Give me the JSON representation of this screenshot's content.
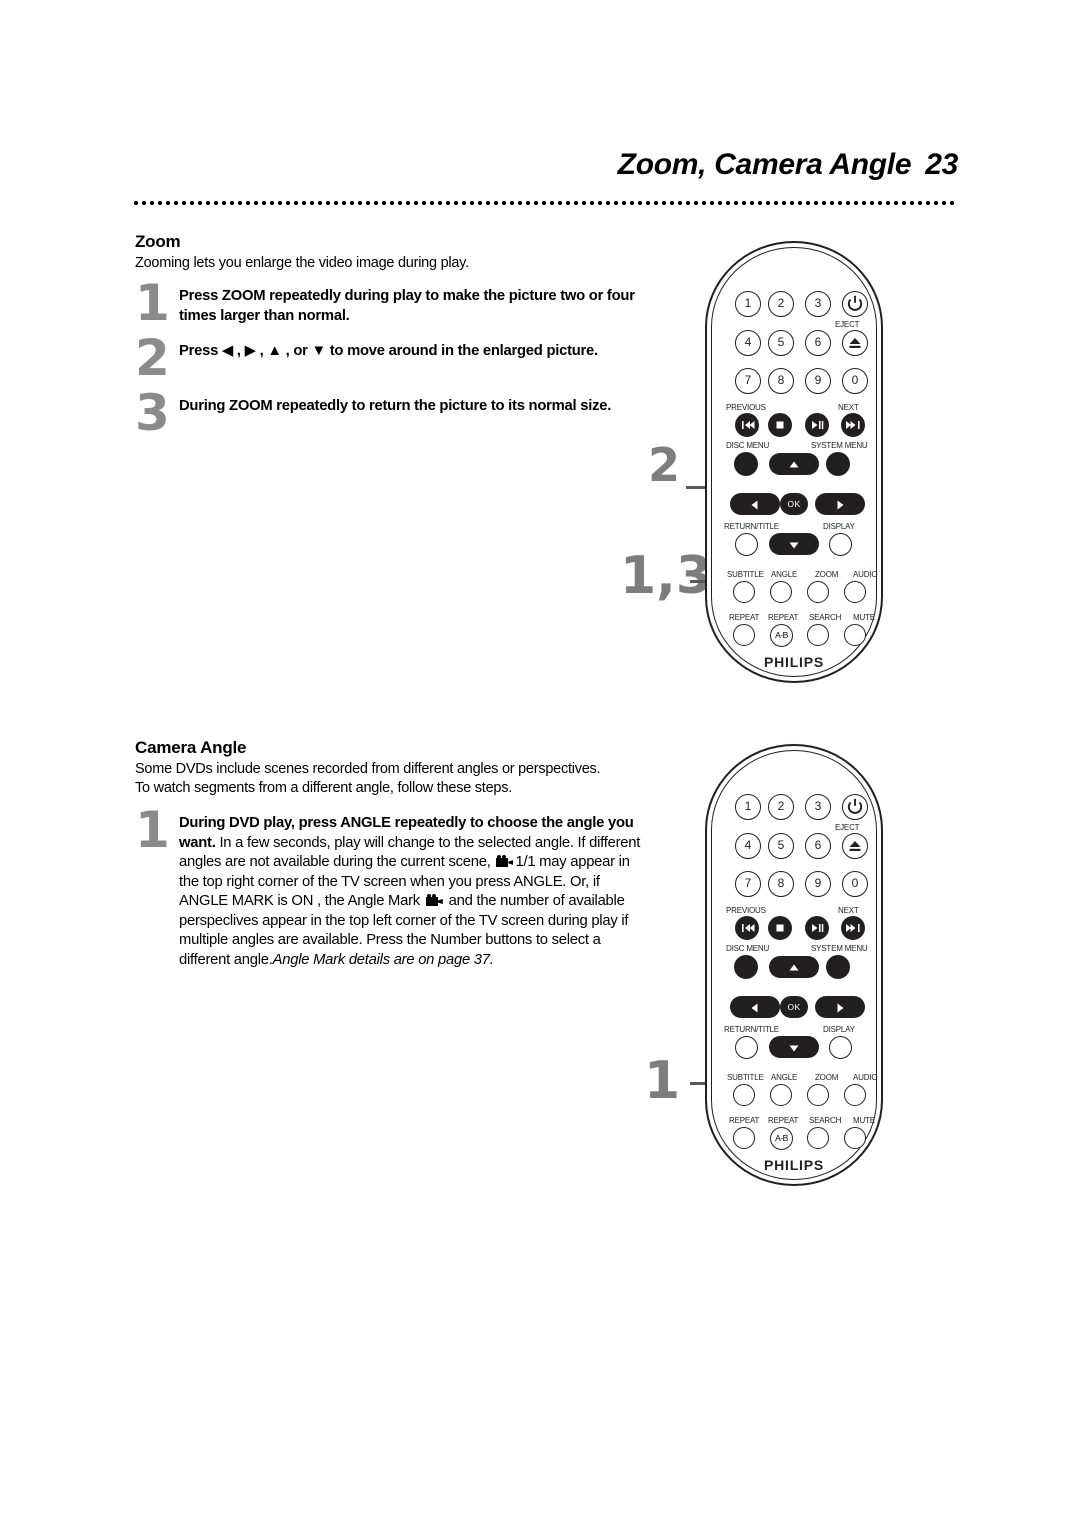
{
  "header": {
    "title": "Zoom, Camera Angle",
    "page_number": "23"
  },
  "zoom_section": {
    "heading": "Zoom",
    "intro": "Zooming lets you enlarge the video image during play.",
    "steps": [
      {
        "number": "1",
        "bold": "Press ZOOM repeatedly during play to make the picture two or four times larger than normal.",
        "rest": ""
      },
      {
        "number": "2",
        "bold": "Press ◀ , ▶ , ▲ , or ▼ to  move around in the enlarged picture.",
        "rest": ""
      },
      {
        "number": "3",
        "bold": "During ZOOM repeatedly to return the picture to its normal size.",
        "rest": ""
      }
    ]
  },
  "camera_angle_section": {
    "heading": "Camera Angle",
    "intro_line1": "Some DVDs include scenes recorded from different angles or perspectives.",
    "intro_line2": "To watch segments from a different angle, follow these steps.",
    "step": {
      "number": "1",
      "bold": "During DVD play, press ANGLE repeatedly to choose the angle you want.",
      "body_a": " In a few seconds, play will change to the selected angle. If different angles are not available during the current scene,",
      "body_b": "1/1 may appear in the top right corner of the TV screen when you press ANGLE.",
      "body_c": "Or, if ANGLE MARK is ON , the Angle Mark",
      "body_d": "and the number of available perspeclives appear in the top left corner of the TV screen during play if multiple angles are available. Press the Number buttons to select a different angle.",
      "body_italic": "Angle Mark details are on page 37."
    }
  },
  "callouts": {
    "remote_top_upper": "2",
    "remote_top_lower": "1,3",
    "remote_bottom": "1"
  },
  "remote": {
    "brand": "PHILIPS",
    "number_keys": [
      "1",
      "2",
      "3",
      "4",
      "5",
      "6",
      "7",
      "8",
      "9",
      "0"
    ],
    "power_label": "",
    "eject_label": "EJECT",
    "transport_labels": {
      "previous": "PREVIOUS",
      "next": "NEXT"
    },
    "menu_labels": {
      "disc_menu": "DISC MENU",
      "system_menu": "SYSTEM MENU"
    },
    "nav_labels": {
      "ok": "OK",
      "return_title": "RETURN/TITLE",
      "display": "DISPLAY"
    },
    "function_row1": [
      "SUBTITLE",
      "ANGLE",
      "ZOOM",
      "AUDIO"
    ],
    "function_row2": [
      "REPEAT",
      "REPEAT",
      "SEARCH",
      "MUTE"
    ],
    "repeat_ab": "A-B"
  },
  "colors": {
    "ink": "#231f20",
    "callout_gray": "#7d7d7d",
    "leader_gray": "#58585a"
  }
}
